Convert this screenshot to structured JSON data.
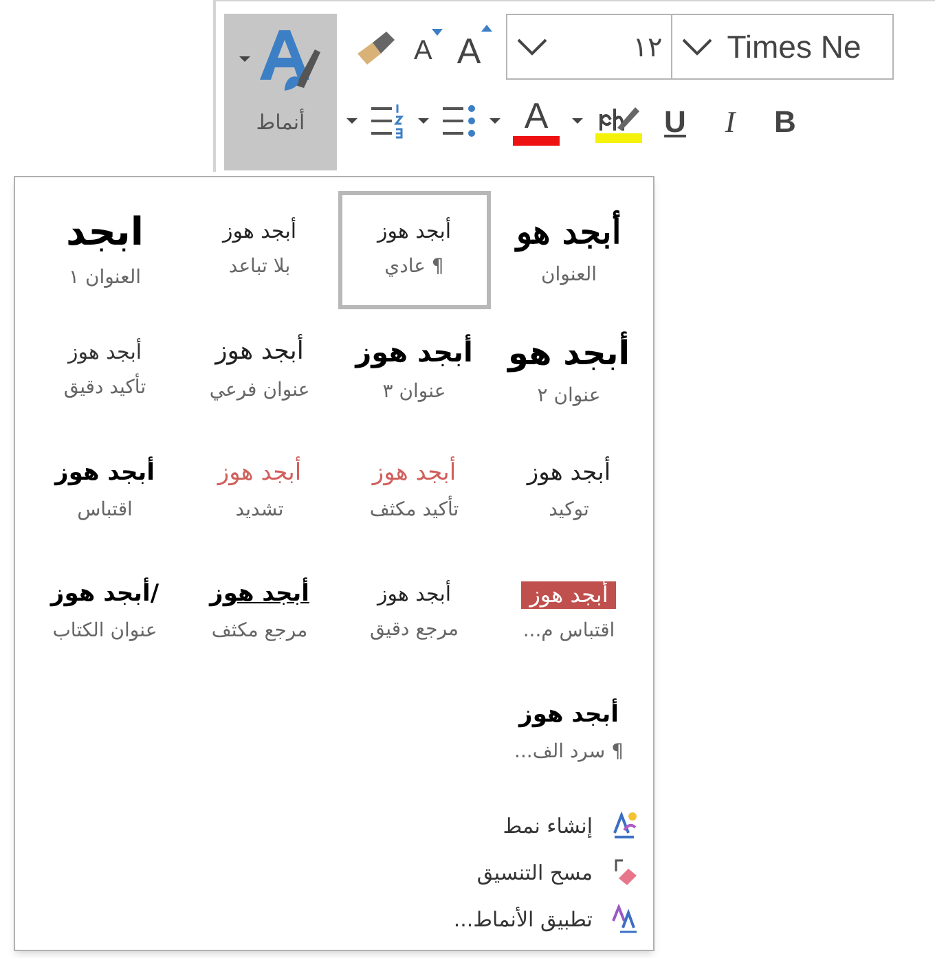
{
  "toolbar": {
    "styles_button": {
      "label": "أنماط",
      "selected": true
    },
    "font_name": "Times Ne",
    "font_size": "١٢",
    "shrink_font": "A",
    "grow_font": "A",
    "font_color": {
      "label": "A",
      "color": "#ee1111"
    },
    "format_buttons": [
      {
        "kind": "bold",
        "label": "B"
      },
      {
        "kind": "italic",
        "label": "I"
      },
      {
        "kind": "underline",
        "label": "U"
      }
    ]
  },
  "styles_gallery": {
    "styles": [
      {
        "kind": "title",
        "preview": "أبجد هو",
        "name": "العنوان",
        "selected": false
      },
      {
        "kind": "normal",
        "preview": "أبجد هوز",
        "name": "¶ عادي",
        "selected": true
      },
      {
        "kind": "plain",
        "preview": "أبجد هوز",
        "name": "بلا تباعد",
        "selected": false
      },
      {
        "kind": "heading1",
        "preview": "ابجد",
        "name": "العنوان ١",
        "selected": false
      },
      {
        "kind": "heading2",
        "preview": "أبجد هو",
        "name": "عنوان ٢",
        "selected": false
      },
      {
        "kind": "heading3",
        "preview": "أبجد هوز",
        "name": "عنوان ٣",
        "selected": false
      },
      {
        "kind": "subtitle",
        "preview": "أبجد هوز",
        "name": "عنوان فرعي",
        "selected": false
      },
      {
        "kind": "subtle",
        "preview": "أبجد هوز",
        "name": "تأكيد دقيق",
        "selected": false
      },
      {
        "kind": "emphasis",
        "preview": "أبجد هوز",
        "name": "توكيد",
        "selected": false
      },
      {
        "kind": "colored",
        "preview": "أبجد هوز",
        "name": "تأكيد مكثف",
        "selected": false
      },
      {
        "kind": "colored",
        "preview": "أبجد هوز",
        "name": "تشديد",
        "selected": false
      },
      {
        "kind": "strong",
        "preview": "أبجد هوز",
        "name": "اقتباس",
        "selected": false
      },
      {
        "kind": "intense_quote",
        "preview": "أبجد هوز",
        "name": "اقتباس م...",
        "selected": false
      },
      {
        "kind": "plain",
        "preview": "أبجد هوز",
        "name": "مرجع دقيق",
        "selected": false
      },
      {
        "kind": "intense_reference",
        "preview": "أبجد هوز",
        "name": "مرجع مكثف",
        "selected": false
      },
      {
        "kind": "strong",
        "preview": "/أبجد هوز",
        "name": "عنوان الكتاب",
        "selected": false
      },
      {
        "kind": "strong",
        "preview": "أبجد هوز",
        "name": "¶ سرد الف...",
        "selected": false
      }
    ],
    "actions": [
      {
        "kind": "create",
        "label": "إنشاء نمط"
      },
      {
        "kind": "clear",
        "label": "مسح التنسيق"
      },
      {
        "kind": "apply",
        "label": "تطبيق الأنماط..."
      }
    ]
  }
}
